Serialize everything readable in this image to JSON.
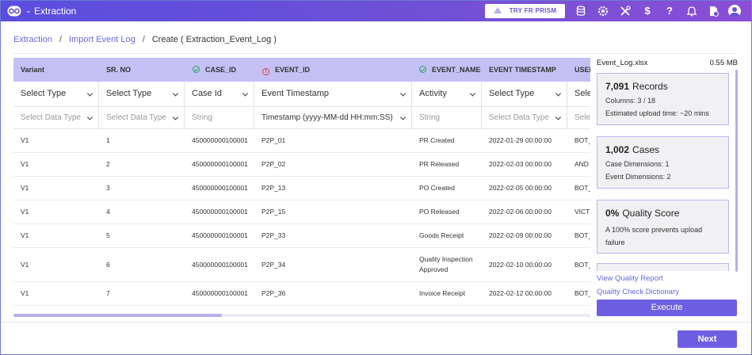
{
  "header": {
    "app_title": "Extraction",
    "try_button": "TRY FR PRISM",
    "brand_color": "#6b50d6"
  },
  "breadcrumb": {
    "items": [
      "Extraction",
      "Import Event Log"
    ],
    "current": "Create ( Extraction_Event_Log )"
  },
  "table": {
    "columns": [
      {
        "label": "Variant",
        "status": "",
        "type_select": "Select Type",
        "data_type": "Select Data Type"
      },
      {
        "label": "SR. NO",
        "status": "",
        "type_select": "Select Type",
        "data_type": "Select Data Type"
      },
      {
        "label": "CASE_ID",
        "status": "ok",
        "type_select": "Case Id",
        "data_type": "String"
      },
      {
        "label": "EVENT_ID",
        "status": "error",
        "type_select": "Event Timestamp",
        "data_type": "Timestamp (yyyy-MM-dd HH:mm:SS)"
      },
      {
        "label": "EVENT_NAME",
        "status": "ok",
        "type_select": "Activity",
        "data_type": "String"
      },
      {
        "label": "EVENT TIMESTAMP",
        "status": "",
        "type_select": "Select Type",
        "data_type": "Select Data Type"
      },
      {
        "label": "USER",
        "status": "",
        "type_select": "Select Type",
        "data_type": "Select Data Type"
      }
    ],
    "rows": [
      [
        "V1",
        "1",
        "450000000100001",
        "P2P_01",
        "PR Created",
        "2022-01-29 00:00:00",
        "BOT_"
      ],
      [
        "V1",
        "2",
        "450000000100001",
        "P2P_02",
        "PR Released",
        "2022-02-03 00:00:00",
        "AND"
      ],
      [
        "V1",
        "3",
        "450000000100001",
        "P2P_13",
        "PO Created",
        "2022-02-05 00:00:00",
        "BOT_"
      ],
      [
        "V1",
        "4",
        "450000000100001",
        "P2P_15",
        "PO Released",
        "2022-02-06 00:00:00",
        "VICT"
      ],
      [
        "V1",
        "5",
        "450000000100001",
        "P2P_33",
        "Goods Receipt",
        "2022-02-09 00:00:00",
        "BOT_"
      ],
      [
        "V1",
        "6",
        "450000000100001",
        "P2P_34",
        "Quality Inspection Approved",
        "2022-02-10 00:00:00",
        "BOT_"
      ],
      [
        "V1",
        "7",
        "450000000100001",
        "P2P_36",
        "Invoice Receipt",
        "2022-02-12 00:00:00",
        "BOT_"
      ]
    ]
  },
  "file": {
    "name": "Event_Log.xlsx",
    "size": "0.55 MB"
  },
  "summary": {
    "records": {
      "count": "7,091",
      "label": "Records",
      "columns": "Columns: 3 / 18",
      "upload_time": "Estimated upload time: ~20 mins"
    },
    "cases": {
      "count": "1,002",
      "label": "Cases",
      "case_dims": "Case Dimensions: 1",
      "event_dims": "Event Dimensions: 2"
    },
    "quality": {
      "score": "0%",
      "label": "Quality Score",
      "note": "A 100% score prevents upload failure"
    }
  },
  "links": {
    "view_report": "View Quality Report",
    "dictionary": "Quality Check Dictionary"
  },
  "buttons": {
    "execute": "Execute",
    "next": "Next"
  }
}
